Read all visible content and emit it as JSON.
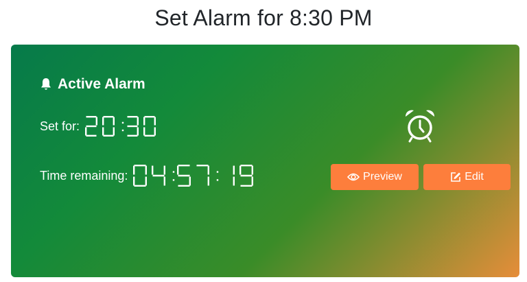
{
  "page": {
    "title": "Set Alarm for 8:30 PM"
  },
  "card": {
    "title": "Active Alarm",
    "title_icon": "bell-icon",
    "set_for_label": "Set for:",
    "set_for_value": "20:30",
    "remaining_label": "Time remaining:",
    "remaining_value": "04:57:19",
    "status_icon": "alarm-clock-icon"
  },
  "buttons": {
    "preview_label": "Preview",
    "preview_icon": "eye-icon",
    "edit_label": "Edit",
    "edit_icon": "edit-icon"
  },
  "colors": {
    "button_bg": "#fd7e3c",
    "gradient_start": "#067a4a",
    "gradient_end": "#e68d3a",
    "text": "#ffffff"
  }
}
